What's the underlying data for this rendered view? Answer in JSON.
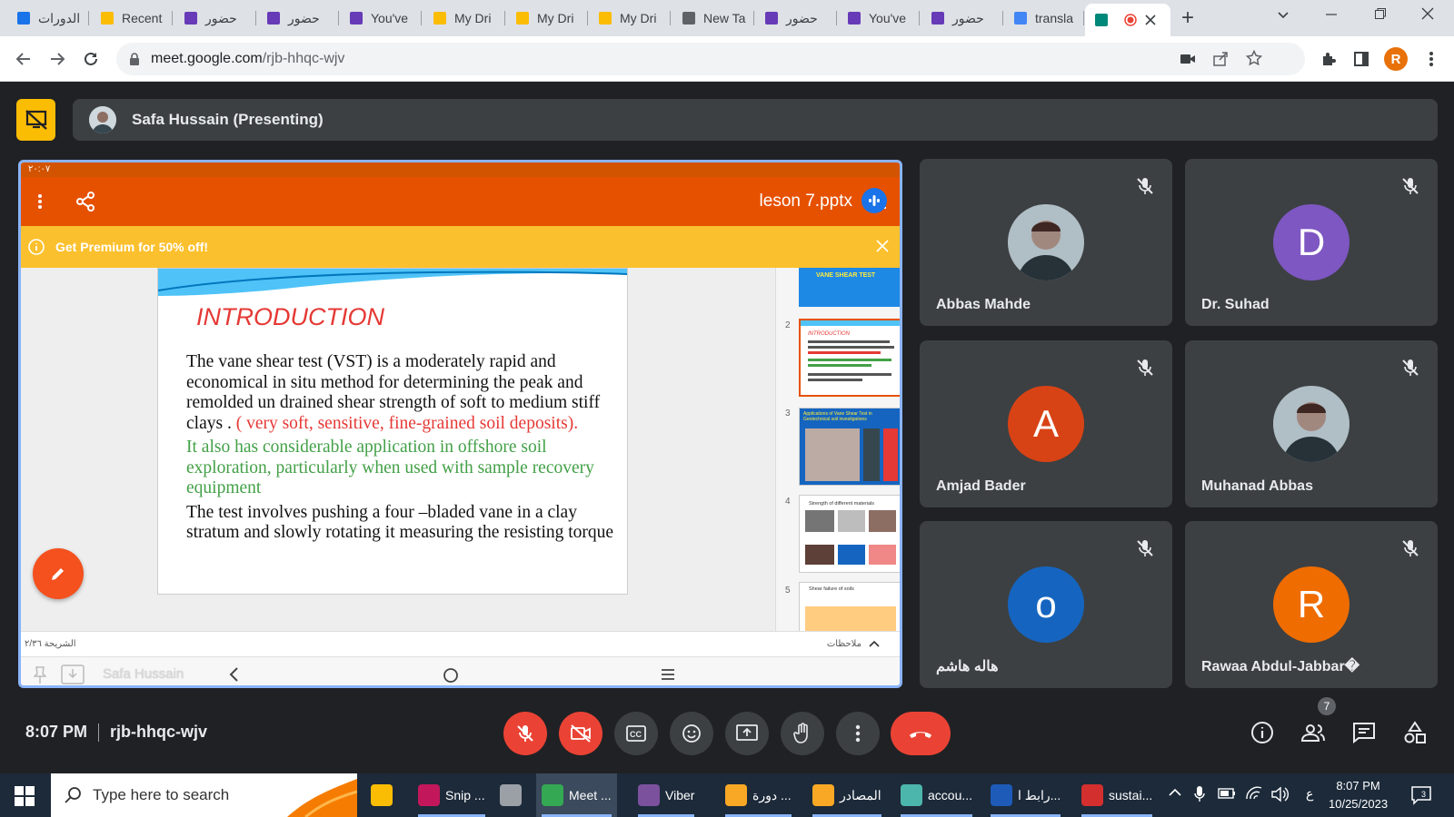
{
  "browser": {
    "tabs": [
      {
        "label": "الدورات",
        "icon": "google-classroom-icon",
        "color": "#1a73e8"
      },
      {
        "label": "Recent",
        "icon": "google-drive-icon",
        "color": "#fbbc04"
      },
      {
        "label": "حضور",
        "icon": "google-forms-icon",
        "color": "#673ab7"
      },
      {
        "label": "حضور",
        "icon": "google-forms-icon",
        "color": "#673ab7"
      },
      {
        "label": "You've",
        "icon": "google-forms-icon",
        "color": "#673ab7"
      },
      {
        "label": "My Dri",
        "icon": "google-drive-icon",
        "color": "#fbbc04"
      },
      {
        "label": "My Dri",
        "icon": "google-drive-icon",
        "color": "#fbbc04"
      },
      {
        "label": "My Dri",
        "icon": "google-drive-icon",
        "color": "#fbbc04"
      },
      {
        "label": "New Ta",
        "icon": "chrome-icon",
        "color": "#5f6368"
      },
      {
        "label": "حضور",
        "icon": "google-forms-icon",
        "color": "#673ab7"
      },
      {
        "label": "You've",
        "icon": "google-forms-icon",
        "color": "#673ab7"
      },
      {
        "label": "حضور",
        "icon": "google-forms-icon",
        "color": "#673ab7"
      },
      {
        "label": "transla",
        "icon": "google-icon",
        "color": "#4285f4"
      },
      {
        "label": "",
        "icon": "google-meet-icon",
        "color": "#00897b",
        "active": true
      }
    ],
    "url_host": "meet.google.com",
    "url_path": "/rjb-hhqc-wjv",
    "profile_initial": "R"
  },
  "meet": {
    "presenter_label": "Safa Hussain (Presenting)",
    "meeting_time": "8:07 PM",
    "meeting_code": "rjb-hhqc-wjv",
    "participant_count": "7",
    "participants": [
      {
        "name": "Abbas Mahde",
        "initial": "",
        "color": "#5f6368",
        "photo": true
      },
      {
        "name": "Dr. Suhad",
        "initial": "D",
        "color": "#7e57c2",
        "photo": false
      },
      {
        "name": "Amjad Bader",
        "initial": "A",
        "color": "#d84315",
        "photo": false
      },
      {
        "name": "Muhanad Abbas",
        "initial": "",
        "color": "#5f6368",
        "photo": true
      },
      {
        "name": "هاله هاشم",
        "initial": "o",
        "color": "#1565c0",
        "photo": false
      },
      {
        "name": "Rawaa Abdul-Jabbar�",
        "initial": "R",
        "color": "#ef6c00",
        "photo": false
      }
    ]
  },
  "shared_screen": {
    "status_time": "٢٠:٠٧",
    "file_name": "leson 7.pptx",
    "premium_banner": "Get Premium for 50% off!",
    "slide": {
      "title": "INTRODUCTION",
      "p1_black": "The vane shear test (VST) is a moderately  rapid and economical in situ method for determining  the peak and remolded  un drained  shear  strength of soft to medium  stiff  clays . ",
      "p1_red": "( very soft, sensitive, fine-grained soil deposits).",
      "p2_green": "It also has considerable application in offshore soil exploration, particularly when used with sample recovery equipment",
      "p3_black": "The test involves pushing a four –bladed  vane in a clay  stratum  and  slowly  rotating  it  measuring  the  resisting  torque"
    },
    "thumb_titles": [
      "VANE SHEAR TEST",
      "INTRODUCTION",
      "Applications of Vane Shear Test in Geotechnical soil investigations",
      "Strength of different materials",
      "Shear failure of soils"
    ],
    "thumb_numbers": [
      "2",
      "3",
      "4",
      "5"
    ],
    "slide_counter": "الشريحة ٢/٣٦",
    "notes_label": "ملاحظات",
    "nav_name": "Safa Hussain"
  },
  "taskbar": {
    "search_placeholder": "Type here to search",
    "items": [
      {
        "label": "",
        "color": "#fbbc04"
      },
      {
        "label": "Snip ...",
        "color": "#c2185b"
      },
      {
        "label": "",
        "color": "#9aa0a6"
      },
      {
        "label": "Meet ...",
        "color": "#34a853"
      },
      {
        "label": "Viber",
        "color": "#7b519d"
      },
      {
        "label": "دورة ...",
        "color": "#f9a825"
      },
      {
        "label": "المصادر",
        "color": "#f9a825"
      },
      {
        "label": "accou...",
        "color": "#4db6ac"
      },
      {
        "label": "رابط ا...",
        "color": "#1e5bb8"
      },
      {
        "label": "sustai...",
        "color": "#d32f2f"
      }
    ],
    "clock_time": "8:07 PM",
    "clock_date": "10/25/2023",
    "lang": "ع",
    "notif_count": "3"
  }
}
